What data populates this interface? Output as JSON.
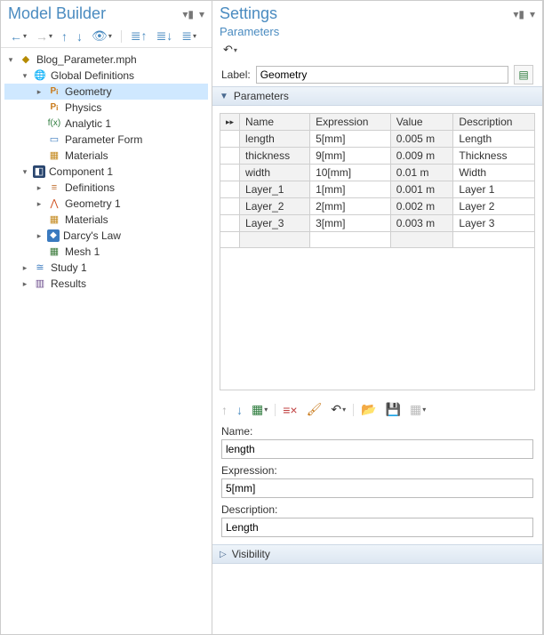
{
  "left": {
    "title": "Model Builder",
    "tree": [
      {
        "indent": 0,
        "exp": "▾",
        "icon": "root",
        "label": "Blog_Parameter.mph",
        "sel": false,
        "interact": true
      },
      {
        "indent": 1,
        "exp": "▾",
        "icon": "globe",
        "label": "Global Definitions",
        "sel": false,
        "interact": true
      },
      {
        "indent": 2,
        "exp": "▸",
        "icon": "pi",
        "label": "Geometry",
        "sel": true,
        "interact": true
      },
      {
        "indent": 2,
        "exp": "",
        "icon": "pi",
        "label": "Physics",
        "sel": false,
        "interact": true
      },
      {
        "indent": 2,
        "exp": "",
        "icon": "fn",
        "label": "Analytic 1",
        "sel": false,
        "interact": true
      },
      {
        "indent": 2,
        "exp": "",
        "icon": "form",
        "label": "Parameter Form",
        "sel": false,
        "interact": true
      },
      {
        "indent": 2,
        "exp": "",
        "icon": "mat",
        "label": "Materials",
        "sel": false,
        "interact": true
      },
      {
        "indent": 1,
        "exp": "▾",
        "icon": "comp",
        "label": "Component 1",
        "sel": false,
        "interact": true
      },
      {
        "indent": 2,
        "exp": "▸",
        "icon": "def",
        "label": "Definitions",
        "sel": false,
        "interact": true
      },
      {
        "indent": 2,
        "exp": "▸",
        "icon": "geom",
        "label": "Geometry 1",
        "sel": false,
        "interact": true
      },
      {
        "indent": 2,
        "exp": "",
        "icon": "mat",
        "label": "Materials",
        "sel": false,
        "interact": true
      },
      {
        "indent": 2,
        "exp": "▸",
        "icon": "darcy",
        "label": "Darcy's Law",
        "sel": false,
        "interact": true
      },
      {
        "indent": 2,
        "exp": "",
        "icon": "mesh",
        "label": "Mesh 1",
        "sel": false,
        "interact": true
      },
      {
        "indent": 1,
        "exp": "▸",
        "icon": "study",
        "label": "Study 1",
        "sel": false,
        "interact": true
      },
      {
        "indent": 1,
        "exp": "▸",
        "icon": "results",
        "label": "Results",
        "sel": false,
        "interact": true
      }
    ]
  },
  "right": {
    "title": "Settings",
    "subtitle": "Parameters",
    "label_title": "Label:",
    "label_value": "Geometry",
    "section_params": "Parameters",
    "table": {
      "headers": [
        "Name",
        "Expression",
        "Value",
        "Description"
      ],
      "rows": [
        {
          "name": "length",
          "expr": "5[mm]",
          "val": "0.005 m",
          "desc": "Length"
        },
        {
          "name": "thickness",
          "expr": "9[mm]",
          "val": "0.009 m",
          "desc": "Thickness"
        },
        {
          "name": "width",
          "expr": "10[mm]",
          "val": "0.01 m",
          "desc": "Width"
        },
        {
          "name": "Layer_1",
          "expr": "1[mm]",
          "val": "0.001 m",
          "desc": "Layer 1"
        },
        {
          "name": "Layer_2",
          "expr": "2[mm]",
          "val": "0.002 m",
          "desc": "Layer 2"
        },
        {
          "name": "Layer_3",
          "expr": "3[mm]",
          "val": "0.003 m",
          "desc": "Layer 3"
        }
      ]
    },
    "fields": {
      "name_label": "Name:",
      "name_value": "length",
      "expr_label": "Expression:",
      "expr_value": "5[mm]",
      "desc_label": "Description:",
      "desc_value": "Length"
    },
    "section_vis": "Visibility"
  }
}
